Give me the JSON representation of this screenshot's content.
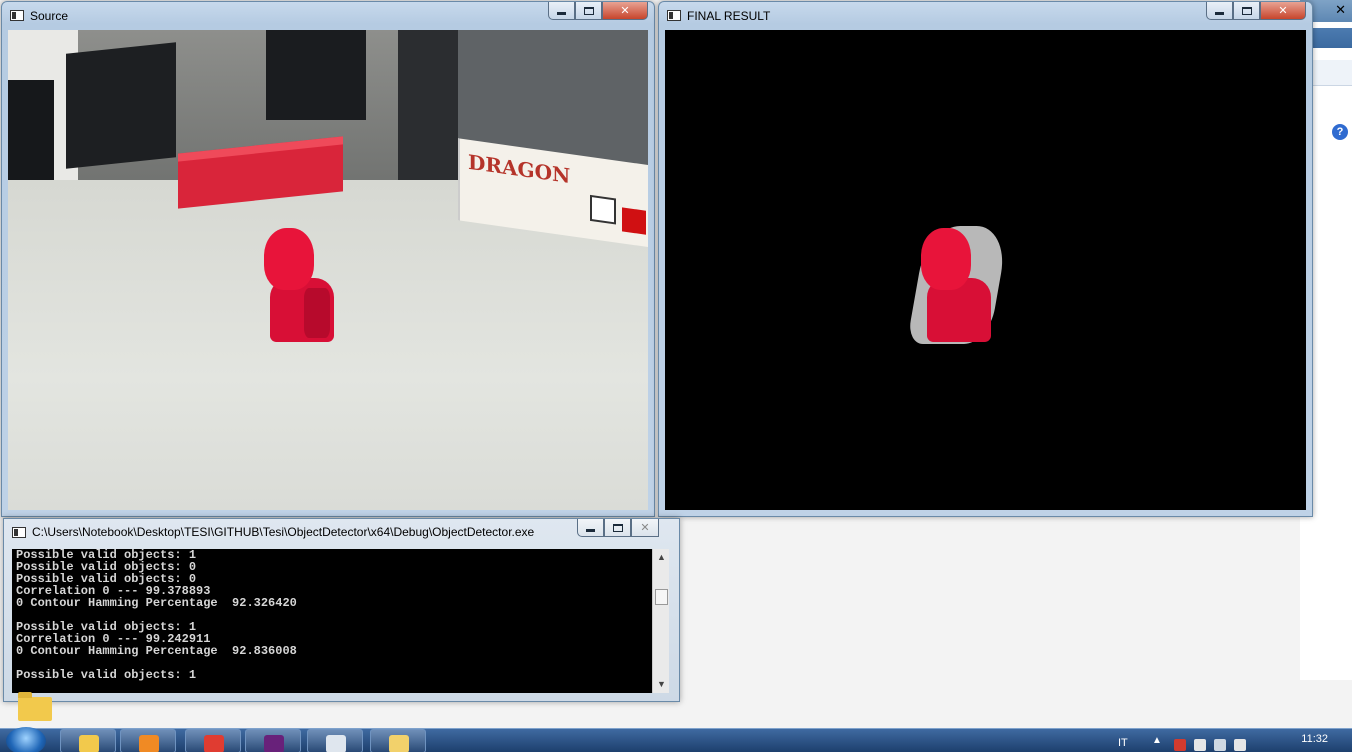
{
  "windows": {
    "source": {
      "title": "Source"
    },
    "final": {
      "title": "FINAL RESULT"
    },
    "console": {
      "title": "C:\\Users\\Notebook\\Desktop\\TESI\\GITHUB\\Tesi\\ObjectDetector\\x64\\Debug\\ObjectDetector.exe",
      "lines": [
        "Possible valid objects: 1",
        "Possible valid objects: 0",
        "Possible valid objects: 0",
        "Correlation 0 --- 99.378893",
        "0 Contour Hamming Percentage  92.326420",
        "",
        "Possible valid objects: 1",
        "Correlation 0 --- 99.242911",
        "0 Contour Hamming Percentage  92.836008",
        "",
        "Possible valid objects: 1"
      ]
    }
  },
  "scene": {
    "box_label": "DRAGON"
  },
  "background_app": {
    "close_glyph": "✕",
    "help_glyph": "?"
  },
  "window_controls": {
    "minimize_glyph": "",
    "close_glyph": "✕"
  },
  "taskbar": {
    "apps": [
      {
        "name": "explorer",
        "color": "#f2c94c"
      },
      {
        "name": "media-player",
        "color": "#f08a24"
      },
      {
        "name": "chrome",
        "color": "#e03c31"
      },
      {
        "name": "visual-studio",
        "color": "#68217a"
      },
      {
        "name": "console",
        "color": "#dfe6ee"
      },
      {
        "name": "paint",
        "color": "#f2d16b"
      }
    ],
    "language": "IT",
    "clock": "11:32"
  },
  "colors": {
    "titlebar": "#b5cbe2",
    "console_bg": "#000000",
    "console_text": "#d6d6d6",
    "taskbar": "#1d3f6d"
  }
}
